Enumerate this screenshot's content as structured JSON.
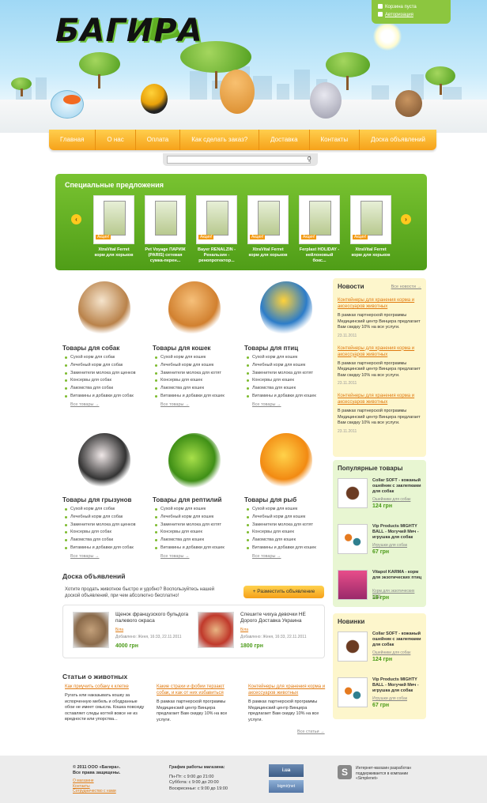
{
  "header": {
    "logo": "БАГИРА",
    "user": {
      "cart": "Корзина пуста",
      "login": "Авторизация"
    }
  },
  "nav": [
    "Главная",
    "О нас",
    "Оплата",
    "Как сделать заказ?",
    "Доставка",
    "Контакты",
    "Доска объявлений"
  ],
  "search": {
    "placeholder": ""
  },
  "special": {
    "title": "Специальные предложения",
    "prev_icon": "chevron-left-icon",
    "next_icon": "chevron-right-icon",
    "products": [
      {
        "title": "XtraVital Ferret корм для хорьков",
        "badge": "Акция!"
      },
      {
        "title": "Pet Voyage ПАРИЖ (PARIS) сетевая сумка-перен...",
        "badge": ""
      },
      {
        "title": "Bayer RENALZIN - Ренальзин - ренопротектор...",
        "badge": "Акция!"
      },
      {
        "title": "XtraVital Ferret корм для хорьков",
        "badge": "Акция!"
      },
      {
        "title": "Ferplast HOLIDAY - нейлоновый бокс...",
        "badge": "Акция!"
      },
      {
        "title": "XtraVital Ferret корм для хорьков",
        "badge": "Акция!"
      }
    ]
  },
  "categories": [
    {
      "title": "Товары для собак",
      "items": [
        "Сухой корм для собак",
        "Лечебный корм для собак",
        "Заменители молока для щенков",
        "Консервы для собак",
        "Лакомства для собак",
        "Витамины и добавки для собак"
      ],
      "more": "Все товары →"
    },
    {
      "title": "Товары для кошек",
      "items": [
        "Сухой корм для кошек",
        "Лечебный корм для кошек",
        "Заменители молока для котят",
        "Консервы для кошек",
        "Лакомства для кошек",
        "Витамины и добавки для кошек"
      ],
      "more": "Все товары →"
    },
    {
      "title": "Товары для птиц",
      "items": [
        "Сухой корм для кошек",
        "Лечебный корм для кошек",
        "Заменители молока для котят",
        "Консервы для кошек",
        "Лакомства для кошек",
        "Витамины и добавки для кошек"
      ],
      "more": "Все товары →"
    },
    {
      "title": "Товары для грызунов",
      "items": [
        "Сухой корм для собак",
        "Лечебный корм для собак",
        "Заменители молока для щенков",
        "Консервы для собак",
        "Лакомства для собак",
        "Витамины и добавки для собак"
      ],
      "more": "Все товары →"
    },
    {
      "title": "Товары для рептилий",
      "items": [
        "Сухой корм для кошек",
        "Лечебный корм для кошек",
        "Заменители молока для котят",
        "Консервы для кошек",
        "Лакомства для кошек",
        "Витамины и добавки для кошек"
      ],
      "more": "Все товары →"
    },
    {
      "title": "Товары для рыб",
      "items": [
        "Сухой корм для кошек",
        "Лечебный корм для кошек",
        "Заменители молока для котят",
        "Консервы для кошек",
        "Лакомства для кошек",
        "Витамины и добавки для кошек"
      ],
      "more": "Все товары →"
    }
  ],
  "news": {
    "title": "Новости",
    "all": "Все новости →",
    "items": [
      {
        "title": "Контейнеры для хранения корма и аксессуаров животных",
        "text": "В рамках партнерской программы Медицинский центр Винцера предлагает Вам скидку 10% на все услуги.",
        "date": "23.11.2011"
      },
      {
        "title": "Контейнеры для хранения корма и аксессуаров животных",
        "text": "В рамках партнерской программы Медицинский центр Винцера предлагает Вам скидку 10% на все услуги.",
        "date": "23.11.2011"
      },
      {
        "title": "Контейнеры для хранения корма и аксессуаров животных",
        "text": "В рамках партнерской программы Медицинский центр Винцера предлагает Вам скидку 10% на все услуги.",
        "date": "23.11.2011"
      }
    ]
  },
  "popular": {
    "title": "Популярные товары",
    "items": [
      {
        "name": "Collar SOFT - кожаный ошейник с заклепками для собак",
        "cat": "Ошейники для собак",
        "price": "124 грн"
      },
      {
        "name": "Vip Products MIGHTY BALL - Могучий Мяч - игрушка для собак",
        "cat": "Игрушки для собак",
        "price": "67 грн"
      },
      {
        "name": "Vitapol KARMA - корм для экзотических птиц",
        "cat": "Корм для экзотических птиц",
        "price": "19 грн"
      }
    ]
  },
  "new_items": {
    "title": "Новинки",
    "items": [
      {
        "name": "Collar SOFT - кожаный ошейник с заклепками для собак",
        "cat": "Ошейники для собак",
        "price": "124 грн"
      },
      {
        "name": "Vip Products MIGHTY BALL - Могучий Мяч - игрушка для собак",
        "cat": "Игрушки для собак",
        "price": "67 грн"
      }
    ]
  },
  "board": {
    "title": "Доска объявлений",
    "text": "Хотите продать животное быстро и удобно? Воспользуйтесь нашей доской объявлений, при чем абсолютно бесплатно!",
    "button": "+ Разместить объявление",
    "ads": [
      {
        "title": "Щенок французского бульдога палевого окраса",
        "cat": "Біла",
        "meta": "Добавлено: Женя, 16:33, 22.11.2011",
        "price": "4000 грн"
      },
      {
        "title": "Спешите чихуа девочки НЕ Дорого Доставка Украина",
        "cat": "Біла",
        "meta": "Добавлено: Женя, 16:33, 22.11.2011",
        "price": "1800 грн"
      }
    ]
  },
  "articles": {
    "title": "Статьи о животных",
    "more": "Все статьи →",
    "items": [
      {
        "title": "Как приучить собаку к клетке",
        "text": "Ругать или наказывать кошку за испорченную мебель и ободранные обои не имеет смысла. Кошка повсюду оставляет следы когтей вовсе не из вредности или упорства..."
      },
      {
        "title": "Какие страхи и фобии терзают собак, и как от них избавиться",
        "text": "В рамках партнерской программы Медицинский центр Винцера предлагает Вам скидку 10% на все услуги."
      },
      {
        "title": "Контейнеры для хранения корма и аксессуаров животных",
        "text": "В рамках партнерской программы Медицинский центр Винцера предлагает Вам скидку 10% на все услуги."
      }
    ]
  },
  "footer": {
    "copyright": "© 2011 ООО «Багира».",
    "rights": "Все права защищены.",
    "links": [
      "О магазине",
      "Контакты",
      "Сотрудничество с нами"
    ],
    "schedule_title": "График работы магазина:",
    "schedule": [
      "Пн-Пт: с 9:00 до 21:00",
      "Суббота: с 9:00 до 20:00",
      "Воскресенье: с 9:00 до 19:00"
    ],
    "badge1": "i.ua",
    "badge2": "bigmir)net",
    "dev_logo": "S",
    "dev_text": "Интернет-магазин разработан поддерживается в компании «Simplenet»"
  }
}
